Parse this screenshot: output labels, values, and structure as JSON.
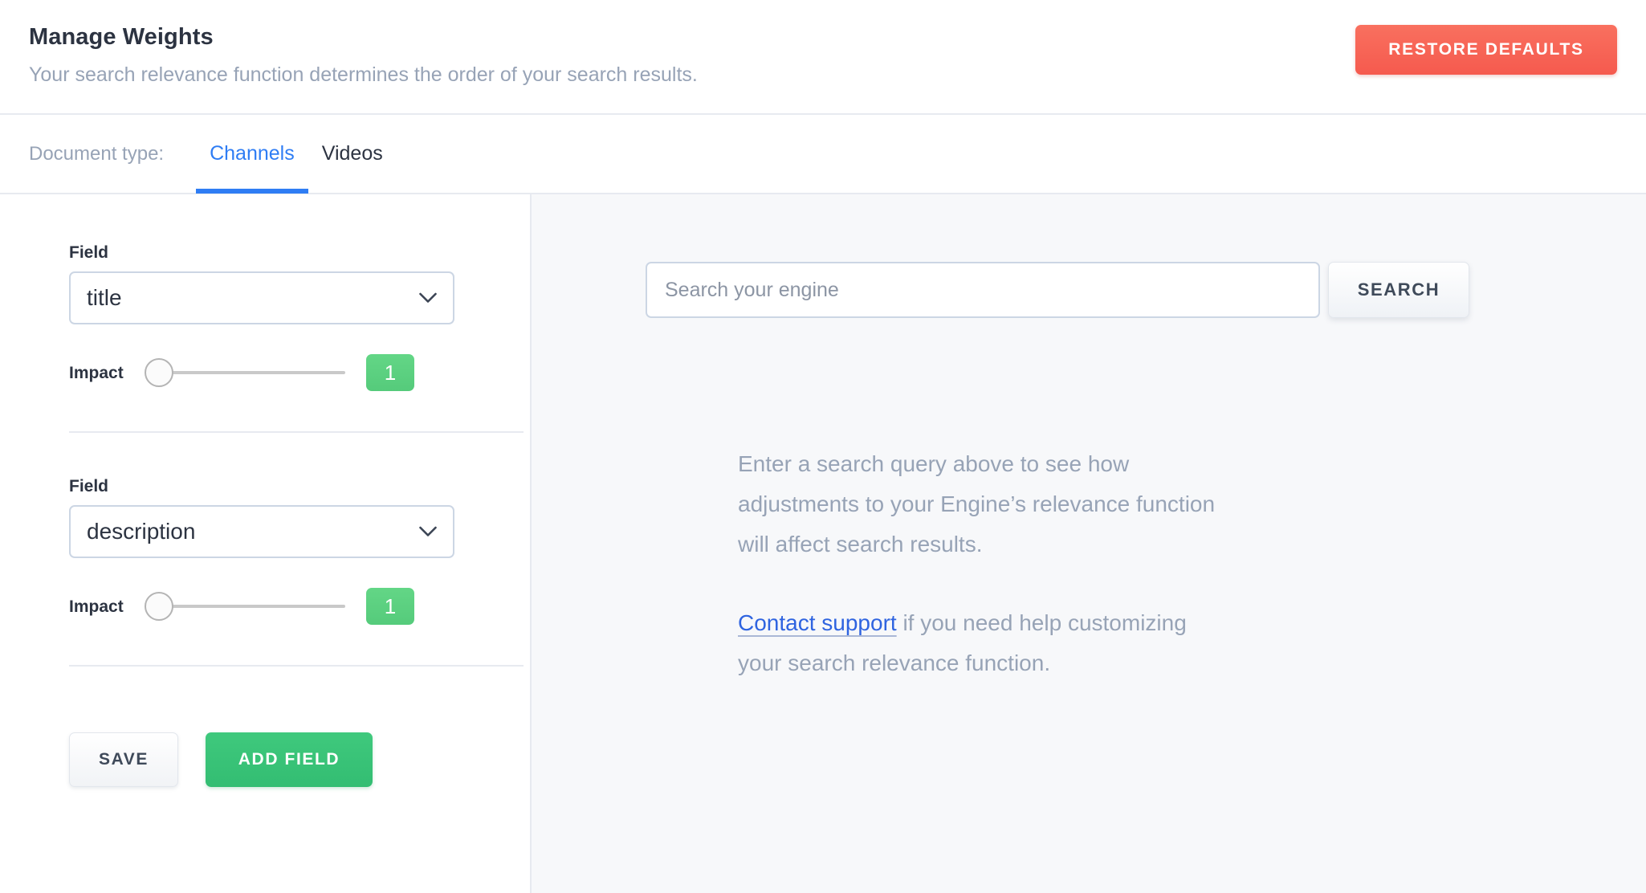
{
  "header": {
    "title": "Manage Weights",
    "subtitle": "Your search relevance function determines the order of your search results.",
    "restore_button": "RESTORE DEFAULTS"
  },
  "tabbar": {
    "label": "Document type:",
    "tabs": [
      {
        "label": "Channels",
        "active": true
      },
      {
        "label": "Videos",
        "active": false
      }
    ]
  },
  "weights_panel": {
    "field_label": "Field",
    "impact_label": "Impact",
    "fields": [
      {
        "field_label": "Field",
        "selected_field": "title",
        "impact_label": "Impact",
        "impact_value": "1",
        "impact_percent": 0
      },
      {
        "field_label": "Field",
        "selected_field": "description",
        "impact_label": "Impact",
        "impact_value": "1",
        "impact_percent": 0
      }
    ],
    "save_button": "SAVE",
    "add_field_button": "ADD FIELD"
  },
  "preview_panel": {
    "search_placeholder": "Search your engine",
    "search_value": "",
    "search_button": "SEARCH",
    "empty_line_1": "Enter a search query above to see how adjustments to your Engine’s relevance function will affect search results.",
    "support_link": "Contact support",
    "empty_line_2_rest": " if you need help customizing your search relevance function."
  },
  "colors": {
    "accent_blue": "#2f7df4",
    "danger_red": "#f55a4e",
    "success_green": "#33bd72",
    "badge_green": "#55cb7b",
    "muted_text": "#97a3b6",
    "dark_text": "#2c3341",
    "panel_bg": "#f7f8fa",
    "border": "#e7eaf0",
    "input_border": "#ccd6e4"
  }
}
